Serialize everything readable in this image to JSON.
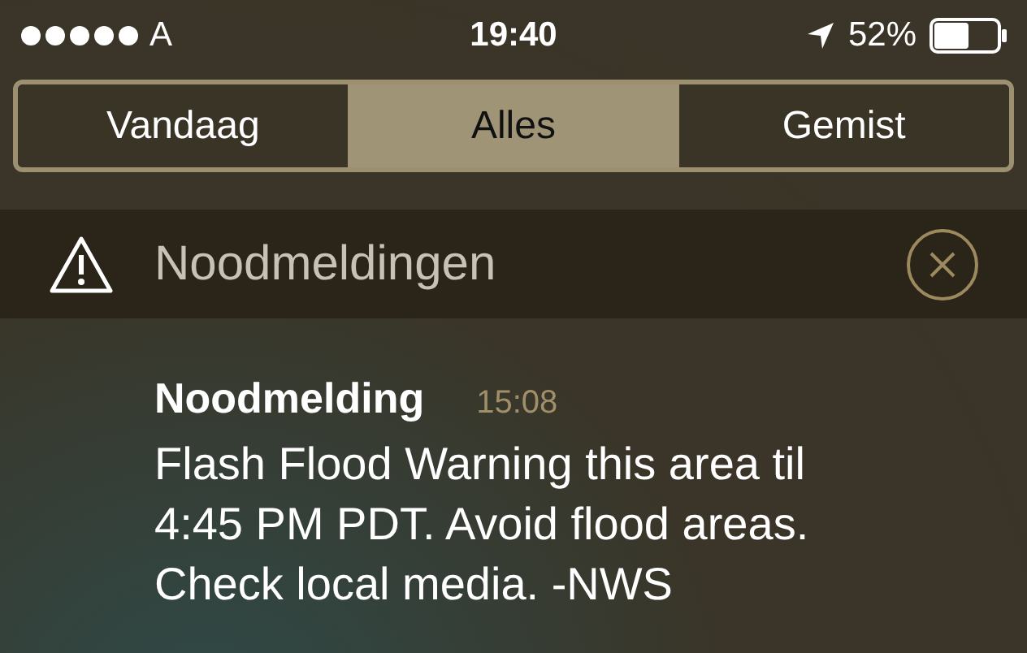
{
  "status_bar": {
    "carrier": "A",
    "time": "19:40",
    "battery_percent": "52%"
  },
  "tabs": [
    {
      "label": "Vandaag",
      "selected": false
    },
    {
      "label": "Alles",
      "selected": true
    },
    {
      "label": "Gemist",
      "selected": false
    }
  ],
  "section": {
    "title": "Noodmeldingen"
  },
  "notification": {
    "title": "Noodmelding",
    "time": "15:08",
    "body": "Flash Flood Warning this area til 4:45 PM PDT. Avoid flood areas. Check local media. -NWS"
  }
}
